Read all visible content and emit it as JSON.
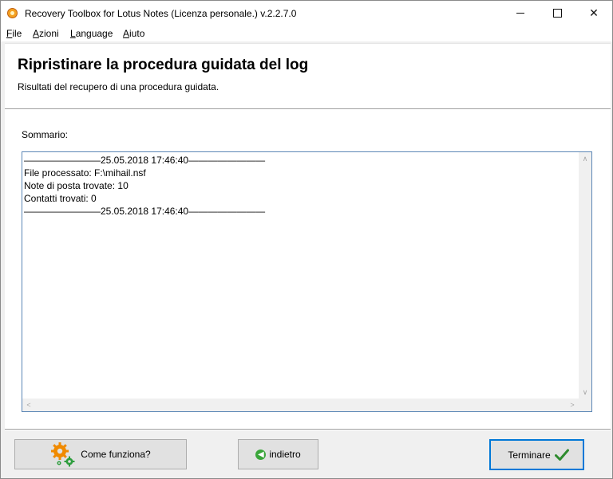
{
  "window": {
    "title": "Recovery Toolbox for Lotus Notes (Licenza personale.) v.2.2.7.0",
    "controls": {
      "minimize": "minimize",
      "maximize": "maximize",
      "close": "✕"
    }
  },
  "menu": {
    "items": [
      {
        "accel": "F",
        "rest": "ile"
      },
      {
        "accel": "A",
        "rest": "zioni"
      },
      {
        "accel": "L",
        "rest": "anguage"
      },
      {
        "accel": "A",
        "rest": "iuto"
      }
    ]
  },
  "header": {
    "title": "Ripristinare la procedura guidata del log",
    "subtitle": "Risultati del recupero di una procedura guidata."
  },
  "main": {
    "summary_label": "Sommario:",
    "log_lines": [
      "————————25.05.2018 17:46:40————————",
      "File processato: F:\\mihail.nsf",
      "Note di posta trovate: 10",
      "Contatti trovati: 0",
      "————————25.05.2018 17:46:40————————"
    ],
    "scroll_arrows": {
      "up": "∧",
      "down": "∨",
      "left": "<",
      "right": ">"
    }
  },
  "footer": {
    "help_button": "Come funziona?",
    "back_button": "indietro",
    "finish_button": "Terminare"
  },
  "colors": {
    "accent": "#0078d7",
    "log_border": "#5b86b5",
    "check_green": "#2e8b2e",
    "gear_orange": "#f08a00",
    "gear_green": "#2e9e3e"
  }
}
